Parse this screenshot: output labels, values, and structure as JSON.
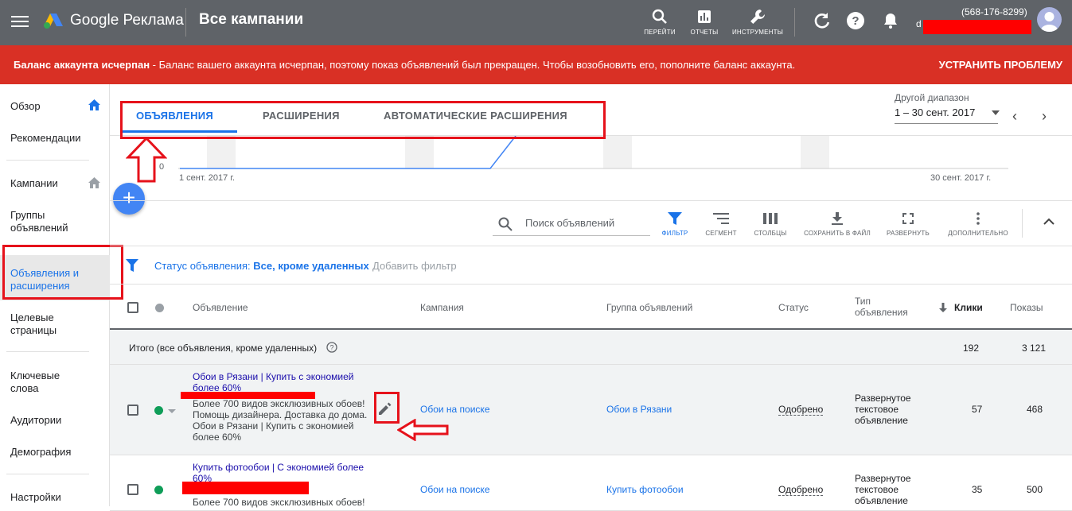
{
  "topbar": {
    "brand": "Google Реклама",
    "page_title": "Все кампании",
    "tools": [
      {
        "label": "ПЕРЕЙТИ",
        "icon": "search-icon"
      },
      {
        "label": "ОТЧЕТЫ",
        "icon": "reports-icon"
      },
      {
        "label": "ИНСТРУМЕНТЫ",
        "icon": "wrench-icon"
      }
    ],
    "account_id": "(568-176-8299)",
    "account_initial": "d"
  },
  "alert": {
    "bold": "Баланс аккаунта исчерпан",
    "text": " - Баланс вашего аккаунта исчерпан, поэтому показ объявлений был прекращен. Чтобы возобновить его, пополните баланс аккаунта.",
    "action": "УСТРАНИТЬ ПРОБЛЕМУ"
  },
  "sidebar": {
    "items": [
      {
        "label": "Обзор"
      },
      {
        "label": "Рекомендации"
      },
      {
        "label": "Кампании"
      },
      {
        "label": "Группы объявлений"
      },
      {
        "label": "Объявления и расширения"
      },
      {
        "label": "Целевые страницы"
      },
      {
        "label": "Ключевые слова"
      },
      {
        "label": "Аудитории"
      },
      {
        "label": "Демография"
      },
      {
        "label": "Настройки"
      }
    ]
  },
  "tabs": [
    "ОБЪЯВЛЕНИЯ",
    "РАСШИРЕНИЯ",
    "АВТОМАТИЧЕСКИЕ РАСШИРЕНИЯ"
  ],
  "date_range": {
    "label": "Другой диапазон",
    "value": "1 – 30 сент. 2017"
  },
  "chart": {
    "y0": "0",
    "x_start": "1 сент. 2017 г.",
    "x_end": "30 сент. 2017 г."
  },
  "toolbar": {
    "search_placeholder": "Поиск объявлений",
    "buttons": [
      "ФИЛЬТР",
      "СЕГМЕНТ",
      "СТОЛБЦЫ",
      "СОХРАНИТЬ В ФАЙЛ",
      "РАЗВЕРНУТЬ",
      "ДОПОЛНИТЕЛЬНО"
    ]
  },
  "filter": {
    "label": "Статус объявления: ",
    "value": "Все, кроме удаленных",
    "add": "Добавить фильтр"
  },
  "table": {
    "headers": {
      "ad": "Объявление",
      "campaign": "Кампания",
      "adgroup": "Группа объявлений",
      "status": "Статус",
      "type": "Тип объявления",
      "clicks": "Клики",
      "impressions": "Показы"
    },
    "totals": {
      "label": "Итого (все объявления, кроме удаленных)",
      "clicks": "192",
      "impressions": "3 121"
    },
    "rows": [
      {
        "title": "Обои в Рязани | Купить с экономией более 60%",
        "desc": "Более 700 видов эксклюзивных обоев! Помощь дизайнера. Доставка до дома. Обои в Рязани | Купить с экономией более 60%",
        "campaign": "Обои на поиске",
        "adgroup": "Обои в Рязани",
        "status": "Одобрено",
        "type": "Развернутое текстовое объявление",
        "clicks": "57",
        "impressions": "468"
      },
      {
        "title": "Купить фотообои | С экономией более 60%",
        "desc": "Более 700 видов эксклюзивных обоев!",
        "campaign": "Обои на поиске",
        "adgroup": "Купить фотообои",
        "status": "Одобрено",
        "type": "Развернутое текстовое объявление",
        "clicks": "35",
        "impressions": "500"
      }
    ]
  },
  "colors": {
    "accent": "#1a73e8",
    "alert": "#d93025",
    "annotation": "#e6121b",
    "topbar": "#5f6368"
  }
}
